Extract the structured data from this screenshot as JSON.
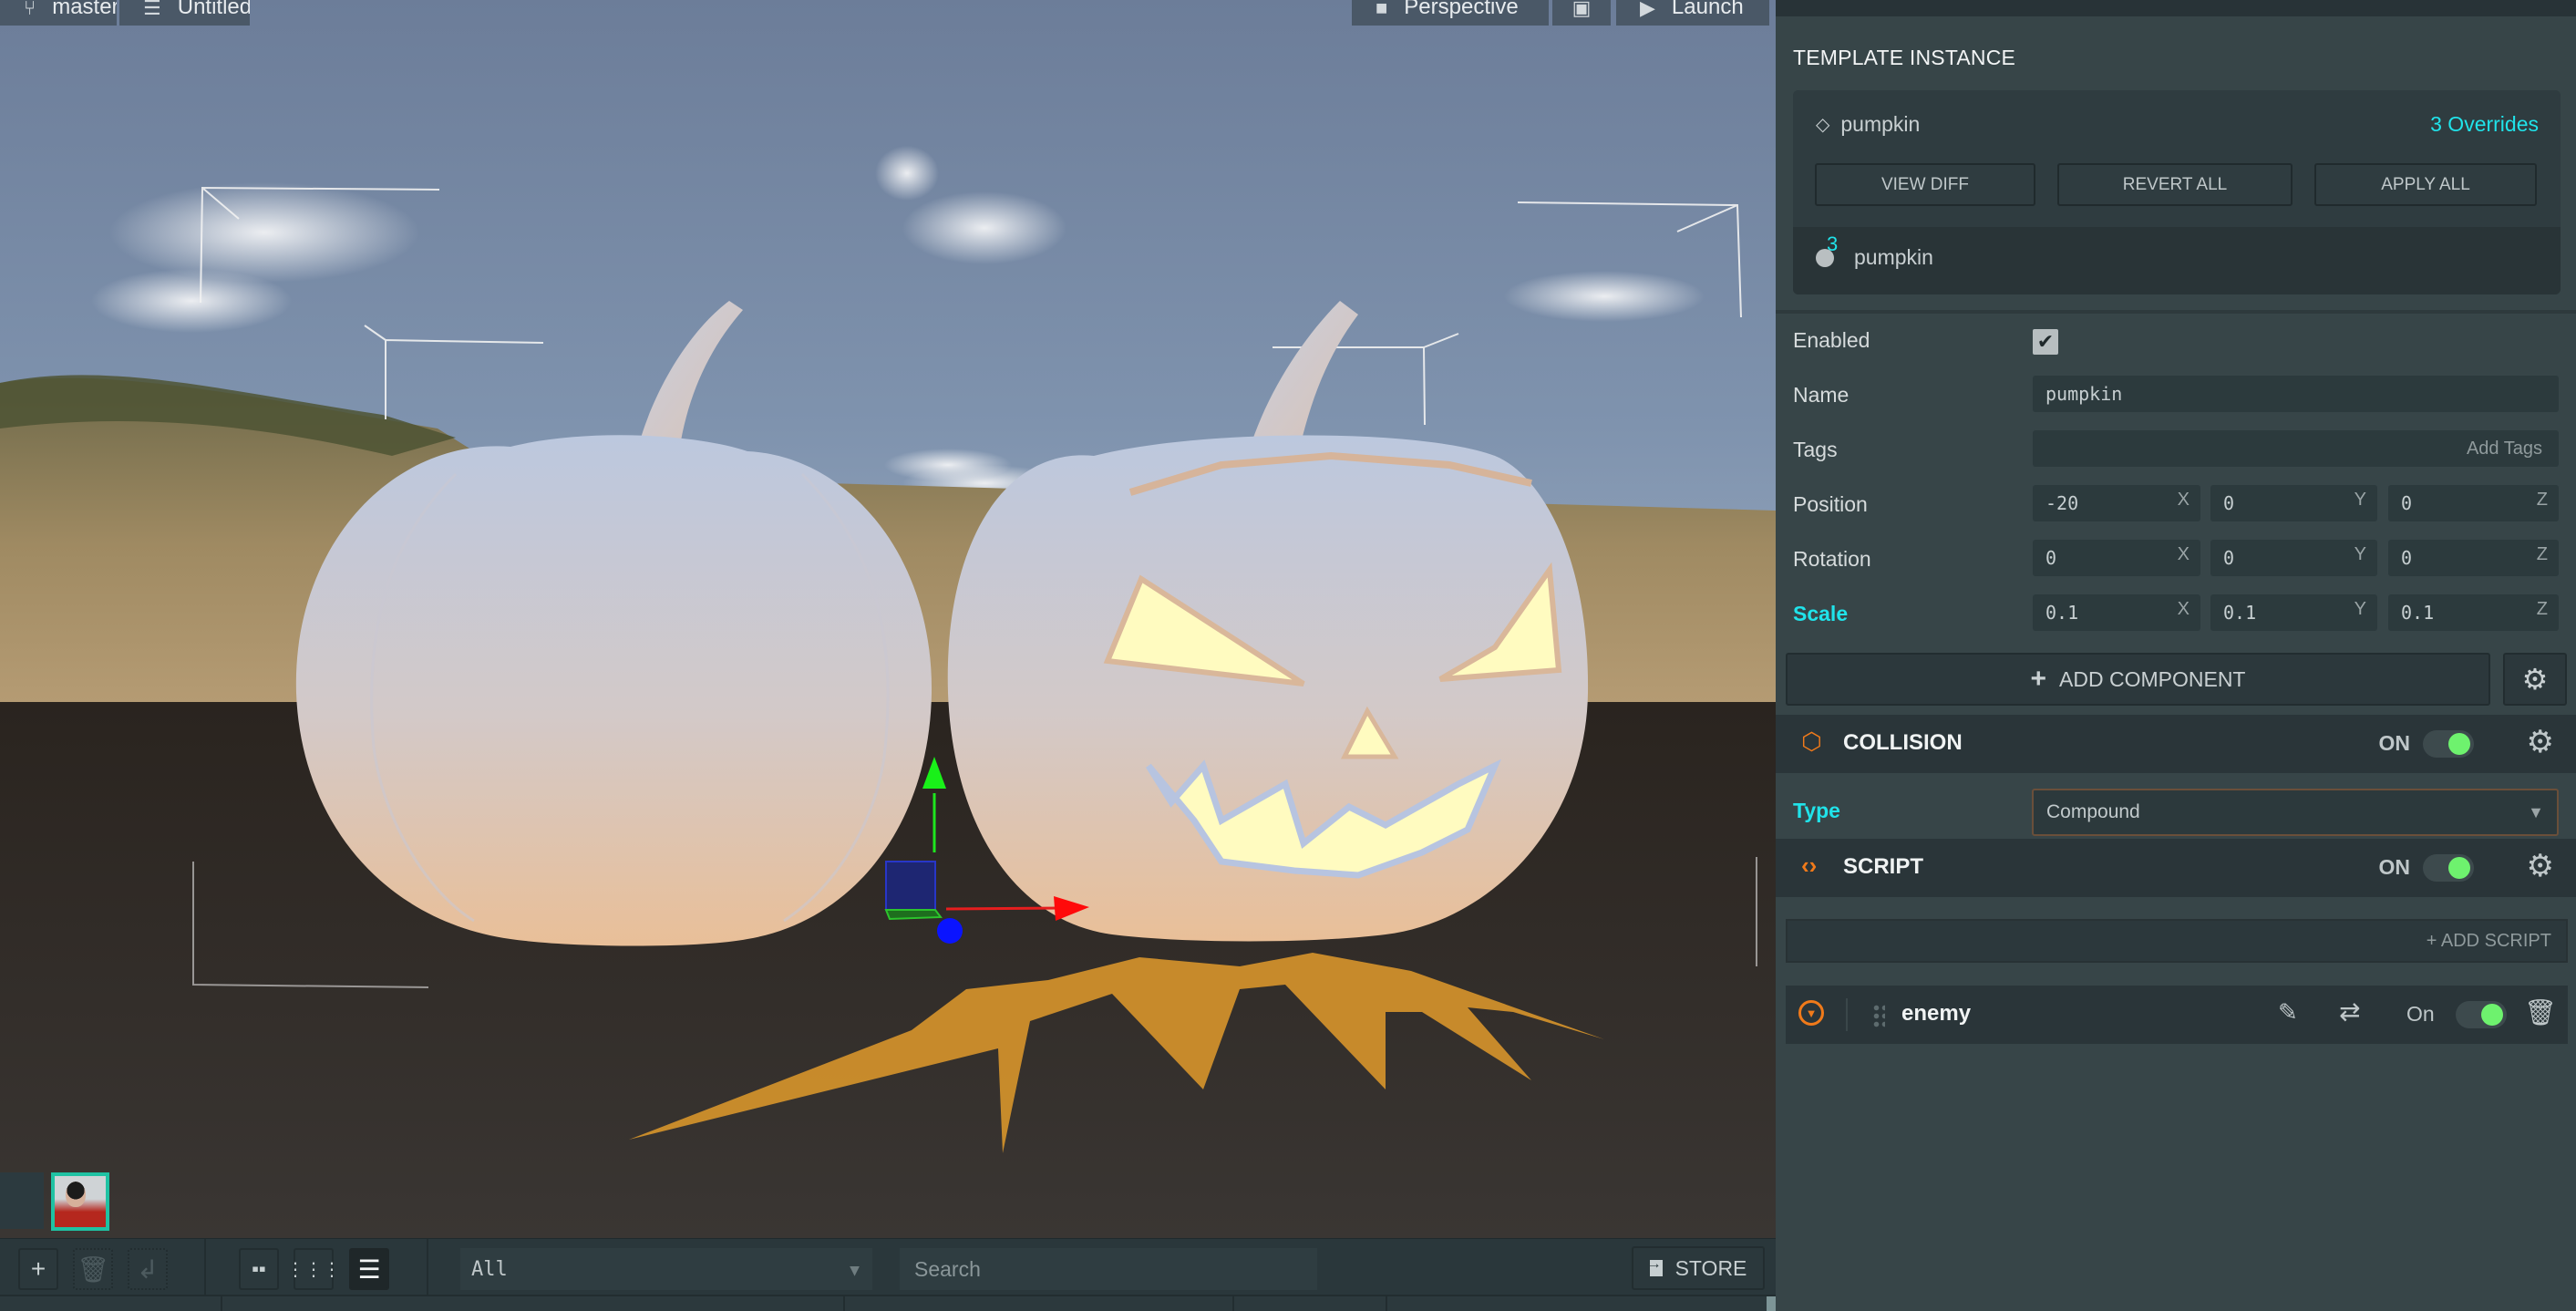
{
  "viewport": {
    "branch_label": "master",
    "scene_label": "Untitled",
    "camera_label": "Perspective",
    "launch_label": "Launch"
  },
  "asset_panel": {
    "filter_value": "All",
    "search_placeholder": "Search",
    "store_label": "STORE"
  },
  "inspector": {
    "section_title": "TEMPLATE INSTANCE",
    "template": {
      "name": "pumpkin",
      "overrides_label": "3 Overrides",
      "buttons": [
        "VIEW DIFF",
        "REVERT ALL",
        "APPLY ALL"
      ],
      "child_override_count": "3",
      "child_name": "pumpkin"
    },
    "entity": {
      "enabled_label": "Enabled",
      "enabled": true,
      "name_label": "Name",
      "name_value": "pumpkin",
      "tags_label": "Tags",
      "tags_placeholder": "Add Tags",
      "position_label": "Position",
      "position": [
        "-20",
        "0",
        "0"
      ],
      "rotation_label": "Rotation",
      "rotation": [
        "0",
        "0",
        "0"
      ],
      "scale_label": "Scale",
      "scale": [
        "0.1",
        "0.1",
        "0.1"
      ],
      "axes": [
        "X",
        "Y",
        "Z"
      ]
    },
    "add_component_label": "ADD COMPONENT",
    "components": {
      "collision": {
        "title": "COLLISION",
        "state": "ON",
        "type_label": "Type",
        "type_value": "Compound"
      },
      "script": {
        "title": "SCRIPT",
        "state": "ON",
        "add_script_label": "+ ADD SCRIPT",
        "scripts": [
          {
            "name": "enemy",
            "state": "On"
          }
        ]
      }
    }
  },
  "colors": {
    "accent_cyan": "#20e3ea",
    "toggle_on": "#6ef26e",
    "component_icon": "#f07a1a",
    "panel_bg": "#374548"
  }
}
